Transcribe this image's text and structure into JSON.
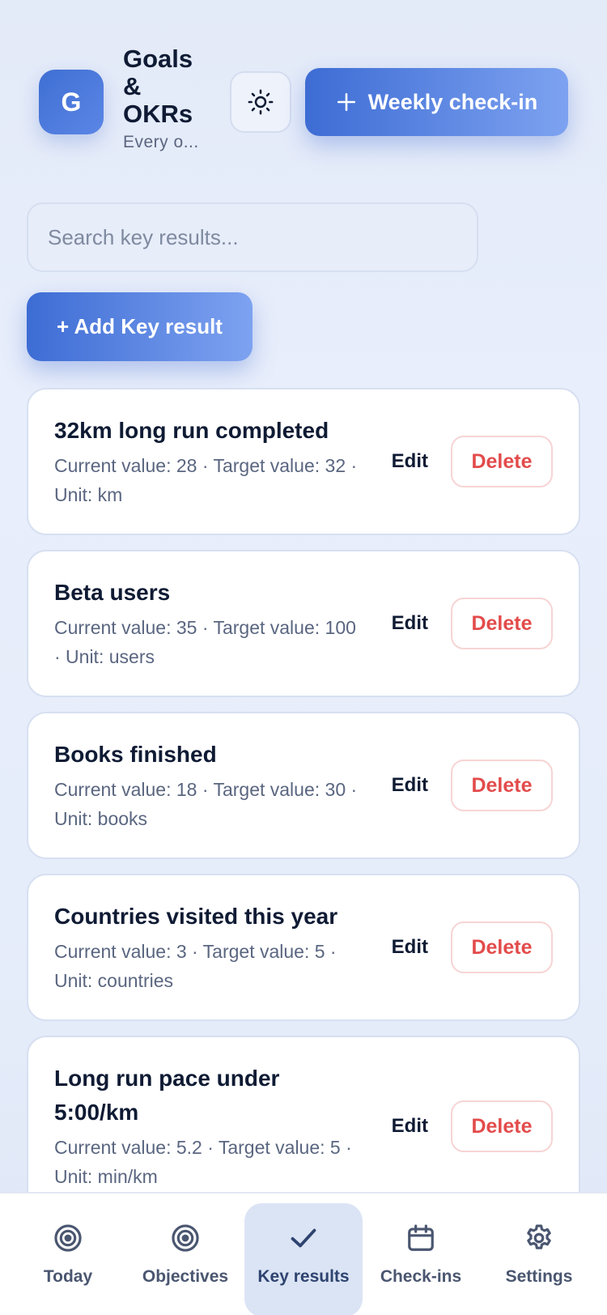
{
  "header": {
    "avatar_letter": "G",
    "title": "Goals & OKRs",
    "subtitle": "Every o...",
    "theme_icon": "sun-icon",
    "checkin_button": {
      "icon": "plus-icon",
      "label": "Weekly check-in"
    }
  },
  "search": {
    "placeholder": "Search key results...",
    "value": ""
  },
  "add_button": {
    "label": "+ Add Key result"
  },
  "key_results": [
    {
      "title": "32km long run completed",
      "meta": "Current value: 28 · Target value: 32 · Unit: km",
      "edit": "Edit",
      "delete": "Delete"
    },
    {
      "title": "Beta users",
      "meta": "Current value: 35 · Target value: 100 · Unit: users",
      "edit": "Edit",
      "delete": "Delete"
    },
    {
      "title": "Books finished",
      "meta": "Current value: 18 · Target value: 30 · Unit: books",
      "edit": "Edit",
      "delete": "Delete"
    },
    {
      "title": "Countries visited this year",
      "meta": "Current value: 3 · Target value: 5 · Unit: countries",
      "edit": "Edit",
      "delete": "Delete"
    },
    {
      "title": "Long run pace under 5:00/km",
      "meta": "Current value: 5.2 · Target value: 5 · Unit: min/km",
      "edit": "Edit",
      "delete": "Delete"
    }
  ],
  "tabs": [
    {
      "label": "Today",
      "icon": "target-icon",
      "active": false
    },
    {
      "label": "Objectives",
      "icon": "target-icon",
      "active": false
    },
    {
      "label": "Key results",
      "icon": "check-icon",
      "active": true
    },
    {
      "label": "Check-ins",
      "icon": "calendar-icon",
      "active": false
    },
    {
      "label": "Settings",
      "icon": "gear-icon",
      "active": false
    }
  ],
  "colors": {
    "accent": "#3d6cd4",
    "danger": "#e34b4b",
    "active_tab_bg": "#dbe4f4"
  }
}
